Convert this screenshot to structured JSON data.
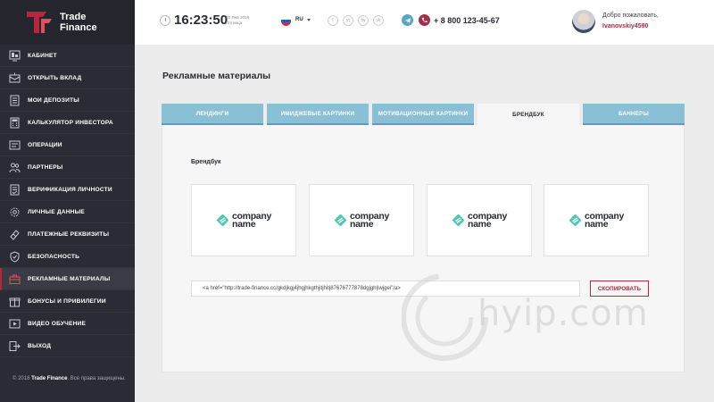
{
  "logo": {
    "line1": "Trade",
    "line2": "Finance"
  },
  "header": {
    "time": "16:23:50",
    "date_line1": "20 Янв 2018",
    "date_line2": "Пятница",
    "language": "RU",
    "social": [
      "f",
      "yt",
      "tw",
      "vk"
    ],
    "phone": "+ 8 800 123-45-67",
    "welcome": "Добро пожаловать,",
    "username": "Ivanovskiy4590"
  },
  "sidebar": {
    "items": [
      {
        "label": "КАБИНЕТ",
        "icon": "dashboard-icon"
      },
      {
        "label": "ОТКРЫТЬ ВКЛАД",
        "icon": "deposit-open-icon"
      },
      {
        "label": "МОИ ДЕПОЗИТЫ",
        "icon": "deposits-icon"
      },
      {
        "label": "КАЛЬКУЛЯТОР ИНВЕСТОРА",
        "icon": "calculator-icon"
      },
      {
        "label": "ОПЕРАЦИИ",
        "icon": "operations-icon"
      },
      {
        "label": "ПАРТНЕРЫ",
        "icon": "partners-icon"
      },
      {
        "label": "ВЕРИФИКАЦИЯ ЛИЧНОСТИ",
        "icon": "verification-icon"
      },
      {
        "label": "ЛИЧНЫЕ ДАННЫЕ",
        "icon": "gear-icon"
      },
      {
        "label": "ПЛАТЕЖНЫЕ РЕКВИЗИТЫ",
        "icon": "payment-icon"
      },
      {
        "label": "БЕЗОПАСНОСТЬ",
        "icon": "shield-icon"
      },
      {
        "label": "РЕКЛАМНЫЕ МАТЕРИАЛЫ",
        "icon": "briefcase-icon"
      },
      {
        "label": "БОНУСЫ И ПРИВИЛЕГИИ",
        "icon": "bonus-icon"
      },
      {
        "label": "ВИДЕО ОБУЧЕНИЕ",
        "icon": "video-icon"
      },
      {
        "label": "ВЫХОД",
        "icon": "logout-icon"
      }
    ],
    "active_index": 10,
    "copyright_prefix": "© 2018",
    "copyright_brand": "Trade Finance",
    "copyright_suffix": ". Все права защищены."
  },
  "main": {
    "title": "Рекламные материалы",
    "tabs": [
      {
        "label": "ЛЕНДИНГИ"
      },
      {
        "label": "ИМИДЖЕВЫЕ КАРТИНКИ"
      },
      {
        "label": "МОТИВАЦИОННЫЕ КАРТИНКИ"
      },
      {
        "label": "БРЕНДБУК"
      },
      {
        "label": "БАННЕРЫ"
      }
    ],
    "active_tab": 3,
    "section_title": "Брендбук",
    "cards": [
      {
        "line1": "company",
        "line2": "name"
      },
      {
        "line1": "company",
        "line2": "name"
      },
      {
        "line1": "company",
        "line2": "name"
      },
      {
        "line1": "company",
        "line2": "name"
      }
    ],
    "code_value": "<a href=\"http://trade-finance.cc/gkdjkgj4jhgjhkgthjitjhitj87676777878dgjgh|iwjgei\"/a>",
    "copy_label": "СКОПИРОВАТЬ"
  },
  "watermark": {
    "text": "hyip.com"
  },
  "colors": {
    "accent": "#b3283f",
    "tab": "#8ac0d6",
    "sidebar": "#2a2b34",
    "brand": "#4cc9b0"
  }
}
